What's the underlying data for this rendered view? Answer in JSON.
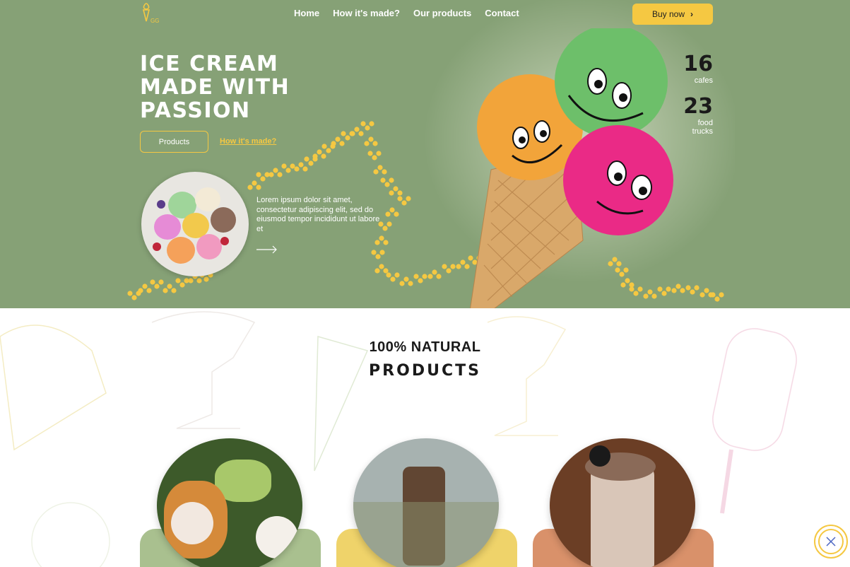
{
  "nav": {
    "logo_icon": "ice-cream-logo-icon",
    "items": [
      "Home",
      "How it's made?",
      "Our products",
      "Contact"
    ],
    "buy_label": "Buy now",
    "buy_icon": "chevron-right-icon"
  },
  "hero": {
    "title_lines": [
      "ICE CREAM",
      "MADE WITH",
      "PASSION"
    ],
    "products_btn": "Products",
    "how_link": "How it's made?",
    "lorem": "Lorem ipsum dolor sit amet, consectetur adipiscing elit, sed do eiusmod tempor incididunt ut labore et",
    "arrow_icon": "arrow-right-icon"
  },
  "stats": [
    {
      "value": "16",
      "label": "cafes"
    },
    {
      "value": "23",
      "label": "food trucks"
    }
  ],
  "products": {
    "title_line1": "100% NATURAL",
    "title_line2": "PRODUCTS"
  },
  "colors": {
    "hero_bg": "#86a176",
    "accent": "#f5c842",
    "card1": "#a9c08f",
    "card2": "#efd36a",
    "card3": "#d9916a"
  }
}
